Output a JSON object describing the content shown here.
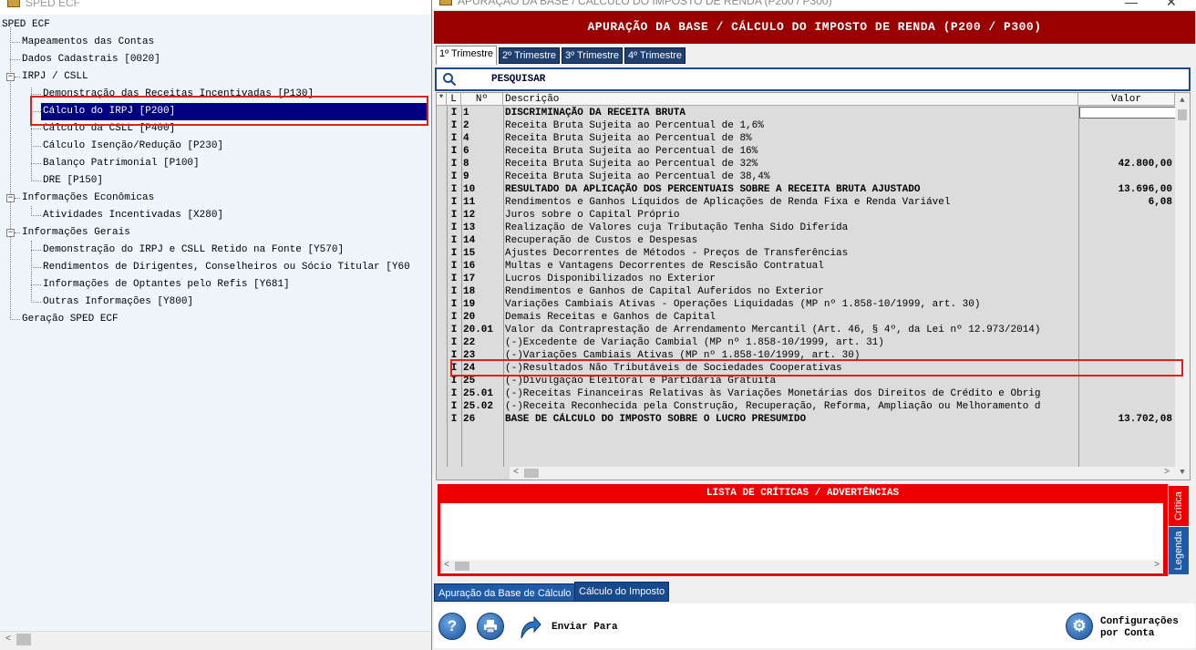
{
  "left_window": {
    "title": "SPED ECF",
    "tree": {
      "root": "SPED ECF",
      "items": [
        {
          "label": "Mapeamentos das Contas",
          "level": 1
        },
        {
          "label": "Dados Cadastrais [0020]",
          "level": 1
        },
        {
          "label": "IRPJ / CSLL",
          "level": 1,
          "expanded": true
        },
        {
          "label": "Demonstração das Receitas Incentivadas [P130]",
          "level": 2
        },
        {
          "label": "Cálculo do IRPJ [P200]",
          "level": 2,
          "selected": true
        },
        {
          "label": "Cálculo da CSLL [P400]",
          "level": 2
        },
        {
          "label": "Cálculo Isenção/Redução [P230]",
          "level": 2
        },
        {
          "label": "Balanço Patrimonial [P100]",
          "level": 2
        },
        {
          "label": "DRE [P150]",
          "level": 2
        },
        {
          "label": "Informações Econômicas",
          "level": 1,
          "expanded": true
        },
        {
          "label": "Atividades Incentivadas [X280]",
          "level": 2
        },
        {
          "label": "Informações Gerais",
          "level": 1,
          "expanded": true
        },
        {
          "label": "Demonstração do IRPJ e CSLL Retido na Fonte [Y570]",
          "level": 2
        },
        {
          "label": "Rendimentos de Dirigentes, Conselheiros ou Sócio Titular [Y60",
          "level": 2
        },
        {
          "label": "Informações de Optantes pelo Refis [Y681]",
          "level": 2
        },
        {
          "label": "Outras Informações [Y800]",
          "level": 2
        },
        {
          "label": "Geração SPED ECF",
          "level": 1
        }
      ]
    }
  },
  "main_window": {
    "title": "APURAÇÃO DA BASE / CÁLCULO DO IMPOSTO DE RENDA (P200 / P300)",
    "header": "APURAÇÃO DA BASE / CÁLCULO DO IMPOSTO DE RENDA (P200 / P300)",
    "quarter_tabs": [
      "1º Trimestre",
      "2º Trimestre",
      "3º Trimestre",
      "4º Trimestre"
    ],
    "search_label": "PESQUISAR",
    "grid": {
      "columns": [
        "*",
        "L",
        "Nº",
        "Descrição",
        "Valor"
      ],
      "rows": [
        {
          "l": "I",
          "n": "1",
          "desc": "DISCRIMINAÇÃO DA RECEITA BRUTA",
          "valor": "",
          "bold": true
        },
        {
          "l": "I",
          "n": "2",
          "desc": "Receita Bruta Sujeita ao Percentual de 1,6%",
          "valor": ""
        },
        {
          "l": "I",
          "n": "4",
          "desc": "Receita Bruta Sujeita ao Percentual de 8%",
          "valor": ""
        },
        {
          "l": "I",
          "n": "6",
          "desc": "Receita Bruta Sujeita ao Percentual de 16%",
          "valor": ""
        },
        {
          "l": "I",
          "n": "8",
          "desc": "Receita Bruta Sujeita ao Percentual de 32%",
          "valor": "42.800,00"
        },
        {
          "l": "I",
          "n": "9",
          "desc": "Receita Bruta Sujeita ao Percentual de 38,4%",
          "valor": ""
        },
        {
          "l": "I",
          "n": "10",
          "desc": "RESULTADO DA APLICAÇÃO DOS PERCENTUAIS SOBRE A RECEITA BRUTA AJUSTADO",
          "valor": "13.696,00",
          "bold": true
        },
        {
          "l": "I",
          "n": "11",
          "desc": "Rendimentos e Ganhos Líquidos de Aplicações de Renda Fixa e Renda Variável",
          "valor": "6,08"
        },
        {
          "l": "I",
          "n": "12",
          "desc": "Juros sobre o Capital Próprio",
          "valor": ""
        },
        {
          "l": "I",
          "n": "13",
          "desc": "Realização de Valores cuja Tributação Tenha Sido Diferida",
          "valor": ""
        },
        {
          "l": "I",
          "n": "14",
          "desc": "Recuperação de Custos e Despesas",
          "valor": ""
        },
        {
          "l": "I",
          "n": "15",
          "desc": "Ajustes Decorrentes de Métodos - Preços de Transferências",
          "valor": ""
        },
        {
          "l": "I",
          "n": "16",
          "desc": "Multas e Vantagens Decorrentes de Rescisão Contratual",
          "valor": ""
        },
        {
          "l": "I",
          "n": "17",
          "desc": "Lucros Disponibilizados no Exterior",
          "valor": ""
        },
        {
          "l": "I",
          "n": "18",
          "desc": "Rendimentos e Ganhos de Capital Auferidos no Exterior",
          "valor": ""
        },
        {
          "l": "I",
          "n": "19",
          "desc": "Variações Cambiais Ativas - Operações Liquidadas (MP nº 1.858-10/1999, art. 30)",
          "valor": ""
        },
        {
          "l": "I",
          "n": "20",
          "desc": "Demais Receitas e Ganhos de Capital",
          "valor": ""
        },
        {
          "l": "I",
          "n": "20.01",
          "desc": "Valor da Contraprestação de Arrendamento Mercantil (Art. 46, § 4º, da Lei nº 12.973/2014)",
          "valor": ""
        },
        {
          "l": "I",
          "n": "22",
          "desc": "(-)Excedente de Variação Cambial (MP nº 1.858-10/1999, art. 31)",
          "valor": ""
        },
        {
          "l": "I",
          "n": "23",
          "desc": "(-)Variações Cambiais Ativas (MP nº 1.858-10/1999, art. 30)",
          "valor": ""
        },
        {
          "l": "I",
          "n": "24",
          "desc": "(-)Resultados Não Tributáveis de Sociedades Cooperativas",
          "valor": ""
        },
        {
          "l": "I",
          "n": "25",
          "desc": "(-)Divulgação Eleitoral e Partidária Gratuita",
          "valor": ""
        },
        {
          "l": "I",
          "n": "25.01",
          "desc": "(-)Receitas Financeiras Relativas às Variações Monetárias dos Direitos de Crédito e Obrig",
          "valor": ""
        },
        {
          "l": "I",
          "n": "25.02",
          "desc": "(-)Receita Reconhecida pela Construção, Recuperação, Reforma, Ampliação ou Melhoramento d",
          "valor": ""
        },
        {
          "l": "I",
          "n": "26",
          "desc": "BASE DE CÁLCULO DO IMPOSTO SOBRE O LUCRO PRESUMIDO",
          "valor": "13.702,08",
          "bold": true
        }
      ]
    },
    "critica": {
      "title": "LISTA DE CRÍTICAS / ADVERTÊNCIAS",
      "side_tabs": [
        "Crítica",
        "Legenda"
      ]
    },
    "bottom_tabs": [
      "Apuração da Base de Cálculo",
      "Cálculo do Imposto"
    ],
    "toolbar": {
      "help_icon": "question-icon",
      "print_icon": "printer-icon",
      "send_label": "Enviar Para",
      "config_label_1": "Configurações",
      "config_label_2": "por Conta"
    }
  },
  "colors": {
    "header_red": "#9a0000",
    "critica_red": "#ee0000",
    "tab_blue": "#1f3f6e",
    "selection_navy": "#000080",
    "highlight_red": "#e02020"
  }
}
